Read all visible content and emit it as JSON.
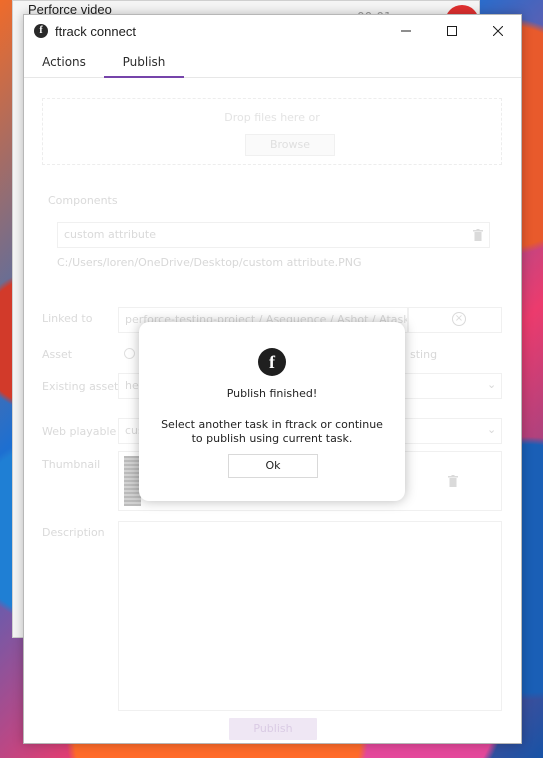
{
  "background_window": {
    "title": "Perforce video",
    "time_partial": "00:01"
  },
  "window": {
    "title": "ftrack connect",
    "logo_letter": "f",
    "controls": [
      "minimize",
      "maximize",
      "close"
    ]
  },
  "tabs": [
    {
      "label": "Actions",
      "selected": false
    },
    {
      "label": "Publish",
      "selected": true
    }
  ],
  "publish_form": {
    "dropzone_text": "Drop files here or",
    "browse_label": "Browse",
    "components_label": "Components",
    "component_name": "custom attribute",
    "component_path": "C:/Users/loren/OneDrive/Desktop/custom attribute.PNG",
    "linked_to_label": "Linked to",
    "linked_to_value": "perforce-testing-project / Asequence / Ashot / Atask",
    "asset_label": "Asset",
    "asset_option_existing": "sting",
    "existing_asset_label": "Existing asset",
    "existing_asset_value": "her",
    "web_playable_label": "Web playable",
    "web_playable_value": "cus",
    "thumbnail_label": "Thumbnail",
    "description_label": "Description",
    "publish_label": "Publish"
  },
  "dialog": {
    "logo_letter": "f",
    "title": "Publish finished!",
    "message": "Select another task in ftrack or continue to publish using current task.",
    "ok_label": "Ok"
  },
  "colors": {
    "accent": "#6f3aa6",
    "publish_disabled_bg": "#efe6f4"
  }
}
